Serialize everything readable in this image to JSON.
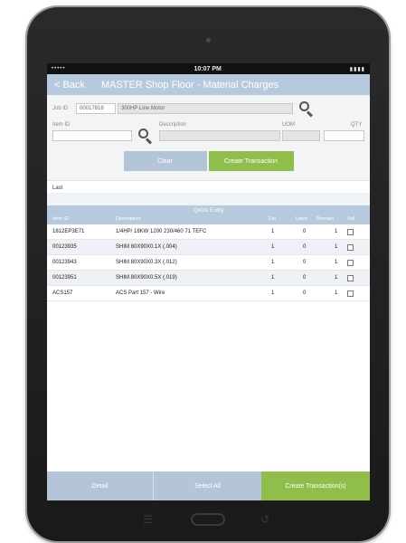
{
  "status": {
    "carrier": "•••••",
    "time": "10:07 PM",
    "battery": "▮▮▮▮"
  },
  "nav": {
    "back_label": "< Back",
    "title": "MASTER Shop Floor - Material Charges"
  },
  "form": {
    "job_label": "Job ID",
    "job_id": "00017818",
    "job_desc": "300HP Line Motor",
    "item_id_label": "Item ID",
    "description_label": "Description",
    "uom_label": "UOM",
    "qty_label": "QTY",
    "item_id_value": "",
    "description_value": "",
    "uom_value": "",
    "qty_value": ""
  },
  "buttons": {
    "clear": "Clear",
    "create_transaction": "Create Transaction"
  },
  "last_label": "Last",
  "quick_entry": {
    "title": "Quick Entry",
    "columns": [
      "Item ID",
      "Description",
      "Est",
      "Used",
      "Remain",
      "Sel"
    ],
    "rows": [
      {
        "item_id": "1812EP3E71",
        "description": "1/4HP/ 18KW 1200 230/460 71 TEFC",
        "est": "1",
        "used": "0",
        "remain": "1"
      },
      {
        "item_id": "00123935",
        "description": "SHIM 80X90X0.1X (.004)",
        "est": "1",
        "used": "0",
        "remain": "1"
      },
      {
        "item_id": "00123943",
        "description": "SHIM 80X90X0.3X (.012)",
        "est": "1",
        "used": "0",
        "remain": "1"
      },
      {
        "item_id": "00123951",
        "description": "SHIM 80X90X0.5X (.019)",
        "est": "1",
        "used": "0",
        "remain": "1"
      },
      {
        "item_id": "ACS157",
        "description": "ACS Part 157 - Wire",
        "est": "1",
        "used": "0",
        "remain": "1"
      }
    ]
  },
  "bottom": {
    "detail": "Detail",
    "select_all": "Select All",
    "create_transactions": "Create Transaction(s)"
  },
  "hardware": {
    "left_icon": "☰",
    "right_icon": "↺"
  },
  "colors": {
    "header_blue": "#b7c9dd",
    "button_blue": "#b4c5d8",
    "accent_green": "#8fbf4a"
  }
}
